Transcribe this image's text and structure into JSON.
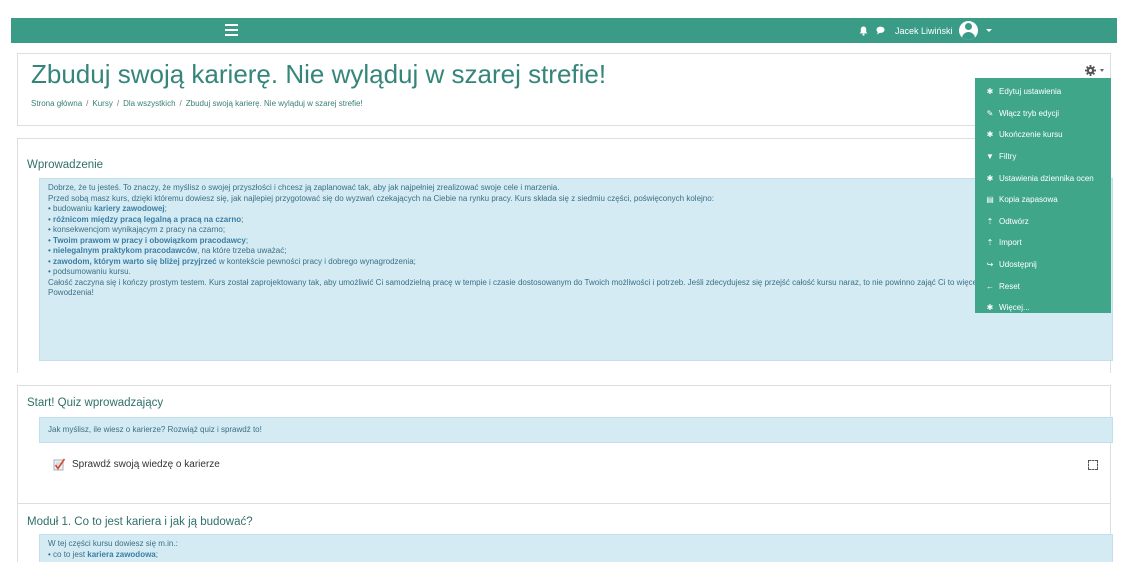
{
  "navbar": {
    "user_name": "Jacek Liwiński"
  },
  "header": {
    "title": "Zbuduj swoją karierę. Nie wyląduj w szarej strefie!",
    "breadcrumb": [
      "Strona główna",
      "Kursy",
      "Dla wszystkich",
      "Zbuduj swoją karierę. Nie wyląduj w szarej strefie!"
    ]
  },
  "menu": {
    "items": [
      {
        "icon": "gear-icon",
        "label": "Edytuj ustawienia"
      },
      {
        "icon": "pencil-icon",
        "label": "Włącz tryb edycji"
      },
      {
        "icon": "gear-icon",
        "label": "Ukończenie kursu"
      },
      {
        "icon": "filter-icon",
        "label": "Filtry"
      },
      {
        "icon": "gear-icon",
        "label": "Ustawienia dziennika ocen"
      },
      {
        "icon": "file-icon",
        "label": "Kopia zapasowa"
      },
      {
        "icon": "upload-icon",
        "label": "Odtwórz"
      },
      {
        "icon": "upload-icon",
        "label": "Import"
      },
      {
        "icon": "share-icon",
        "label": "Udostępnij"
      },
      {
        "icon": "arrow-left-icon",
        "label": "Reset"
      },
      {
        "icon": "gear-icon",
        "label": "Więcej..."
      }
    ]
  },
  "intro": {
    "title": "Wprowadzenie",
    "p1": "Dobrze, że tu jesteś. To znaczy, że myślisz o swojej przyszłości i chcesz ją zaplanować tak, aby jak najpełniej zrealizować swoje cele i marzenia.",
    "p2": "Przed sobą masz kurs, dzięki któremu dowiesz się, jak najlepiej przygotować się do wyzwań czekających na Ciebie na rynku pracy. Kurs składa się z siedmiu części, poświęconych kolejno:",
    "b1_pre": "budowaniu ",
    "b1_bold": "kariery zawodowej",
    "b1_post": ";",
    "b2_bold": "różnicom między pracą legalną a pracą na czarno",
    "b2_post": ";",
    "b3": "konsekwencjom wynikającym z pracy na czarno;",
    "b4_bold": "Twoim prawom w pracy i obowiązkom pracodawcy",
    "b4_post": ";",
    "b5_bold": "nielegalnym praktykom pracodawców",
    "b5_post": ", na które trzeba uważać;",
    "b6_bold": "zawodom, którym warto się bliżej przyjrzeć",
    "b6_post": " w kontekście pewności pracy i dobrego wynagrodzenia;",
    "b7": "podsumowaniu kursu.",
    "p3": "Całość zaczyna się i kończy prostym testem. Kurs został zaprojektowany tak, aby umożliwić Ci samodzielną pracę w tempie i czasie dostosowanym do Twoich możliwości i potrzeb. Jeśli zdecydujesz się przejść całość kursu naraz, to nie powinno zająć Ci to więcej niż dwie godziny.",
    "p4": "Powodzenia!"
  },
  "start": {
    "title": "Start! Quiz wprowadzający",
    "summary": "Jak myślisz, ile wiesz o karierze? Rozwiąż quiz i sprawdź to!",
    "activity": "Sprawdź swoją wiedzę o karierze"
  },
  "module1": {
    "title": "Moduł 1. Co to jest kariera i jak ją budować?",
    "p1": "W tej części kursu dowiesz się m.in.:",
    "b1_pre": "co to jest ",
    "b1_bold": "kariera zawodowa",
    "b1_post": ";"
  }
}
